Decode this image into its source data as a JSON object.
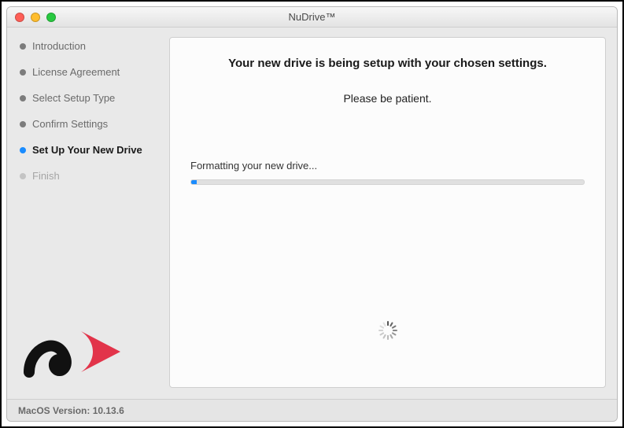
{
  "window": {
    "title": "NuDrive™"
  },
  "sidebar": {
    "steps": [
      {
        "label": "Introduction",
        "state": "done"
      },
      {
        "label": "License Agreement",
        "state": "done"
      },
      {
        "label": "Select Setup Type",
        "state": "done"
      },
      {
        "label": "Confirm Settings",
        "state": "done"
      },
      {
        "label": "Set Up Your New Drive",
        "state": "active"
      },
      {
        "label": "Finish",
        "state": "upcoming"
      }
    ]
  },
  "main": {
    "heading": "Your new drive is being setup with your chosen settings.",
    "sub": "Please be patient.",
    "status": "Formatting your new drive...",
    "progress_percent": 1.5
  },
  "footer": {
    "os_label": "MacOS Version: 10.13.6"
  }
}
